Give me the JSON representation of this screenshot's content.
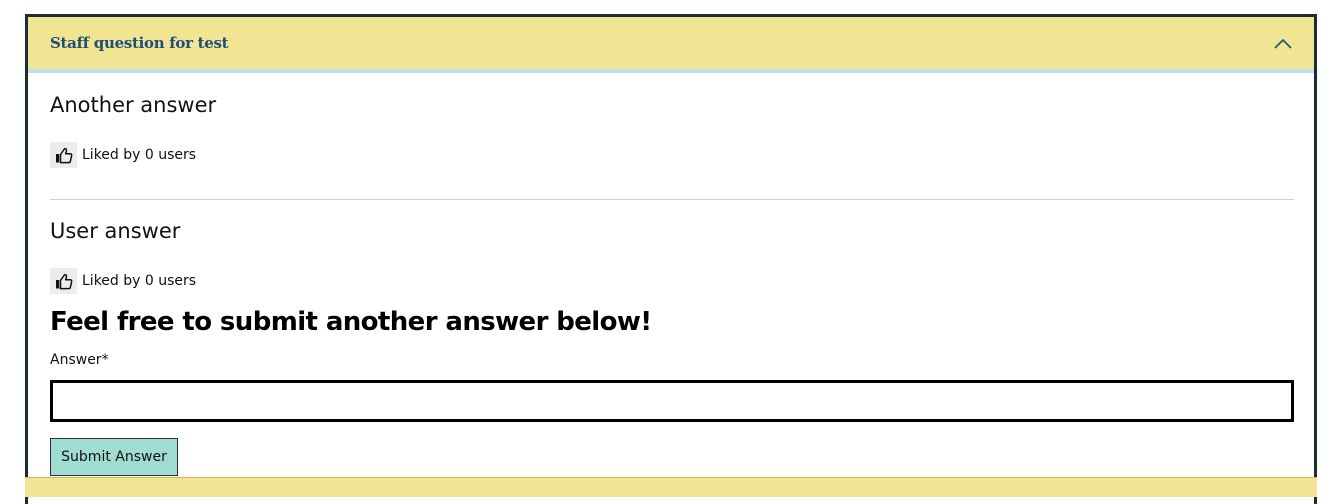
{
  "accordion": {
    "title": "Staff question for test",
    "chevron_icon": "chevron-up-icon",
    "header_color": "#f1e594",
    "title_color": "#1d4e7a"
  },
  "answers": [
    {
      "text": "Another answer",
      "likes_label": "Liked by 0 users",
      "like_icon": "thumbs-up-icon"
    },
    {
      "text": "User answer",
      "likes_label": "Liked by 0 users",
      "like_icon": "thumbs-up-icon"
    }
  ],
  "form": {
    "heading": "Feel free to submit another answer below!",
    "answer_label": "Answer*",
    "answer_value": "",
    "submit_label": "Submit Answer",
    "submit_color": "#9fdcd2"
  }
}
